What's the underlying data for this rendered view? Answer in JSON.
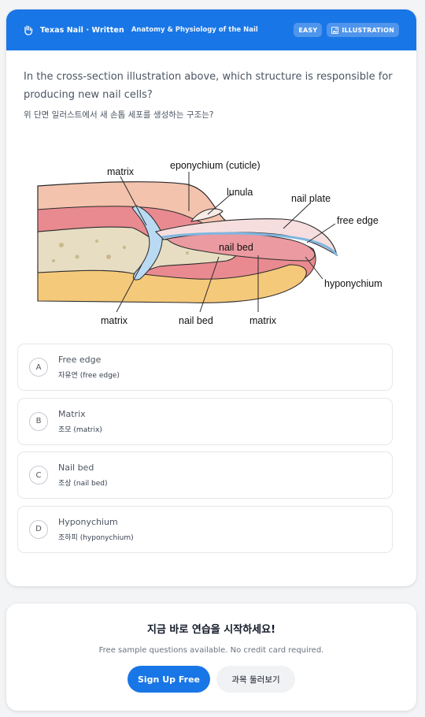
{
  "header": {
    "brand": "Texas Nail · Written",
    "topic": "Anatomy & Physiology of the Nail",
    "badges": {
      "difficulty": "EASY",
      "type": "ILLUSTRATION"
    }
  },
  "question": {
    "text_en": "In the cross-section illustration above, which structure is responsible for producing new nail cells?",
    "text_ko": "위 단면 일러스트에서 새 손톱 세포를 생성하는 구조는?"
  },
  "illustration": {
    "labels": {
      "matrix_top": "matrix",
      "eponychium": "eponychium  (cuticle)",
      "lunula": "lunula",
      "nail_plate": "nail plate",
      "free_edge": "free edge",
      "nail_bed_inner": "nail bed",
      "hyponychium": "hyponychium",
      "matrix_bottom_left": "matrix",
      "nail_bed_bottom": "nail bed",
      "matrix_bottom_right": "matrix"
    }
  },
  "options": [
    {
      "letter": "A",
      "en": "Free edge",
      "ko": "자유연 (free edge)"
    },
    {
      "letter": "B",
      "en": "Matrix",
      "ko": "조모 (matrix)"
    },
    {
      "letter": "C",
      "en": "Nail bed",
      "ko": "조상 (nail bed)"
    },
    {
      "letter": "D",
      "en": "Hyponychium",
      "ko": "조하피 (hyponychium)"
    }
  ],
  "cta": {
    "title": "지금 바로 연습을 시작하세요!",
    "subtitle": "Free sample questions available. No credit card required.",
    "primary_button": "Sign Up Free",
    "secondary_button": "과목 둘러보기"
  },
  "colors": {
    "accent": "#1976e6",
    "badge_bg": "#4f95ec"
  }
}
